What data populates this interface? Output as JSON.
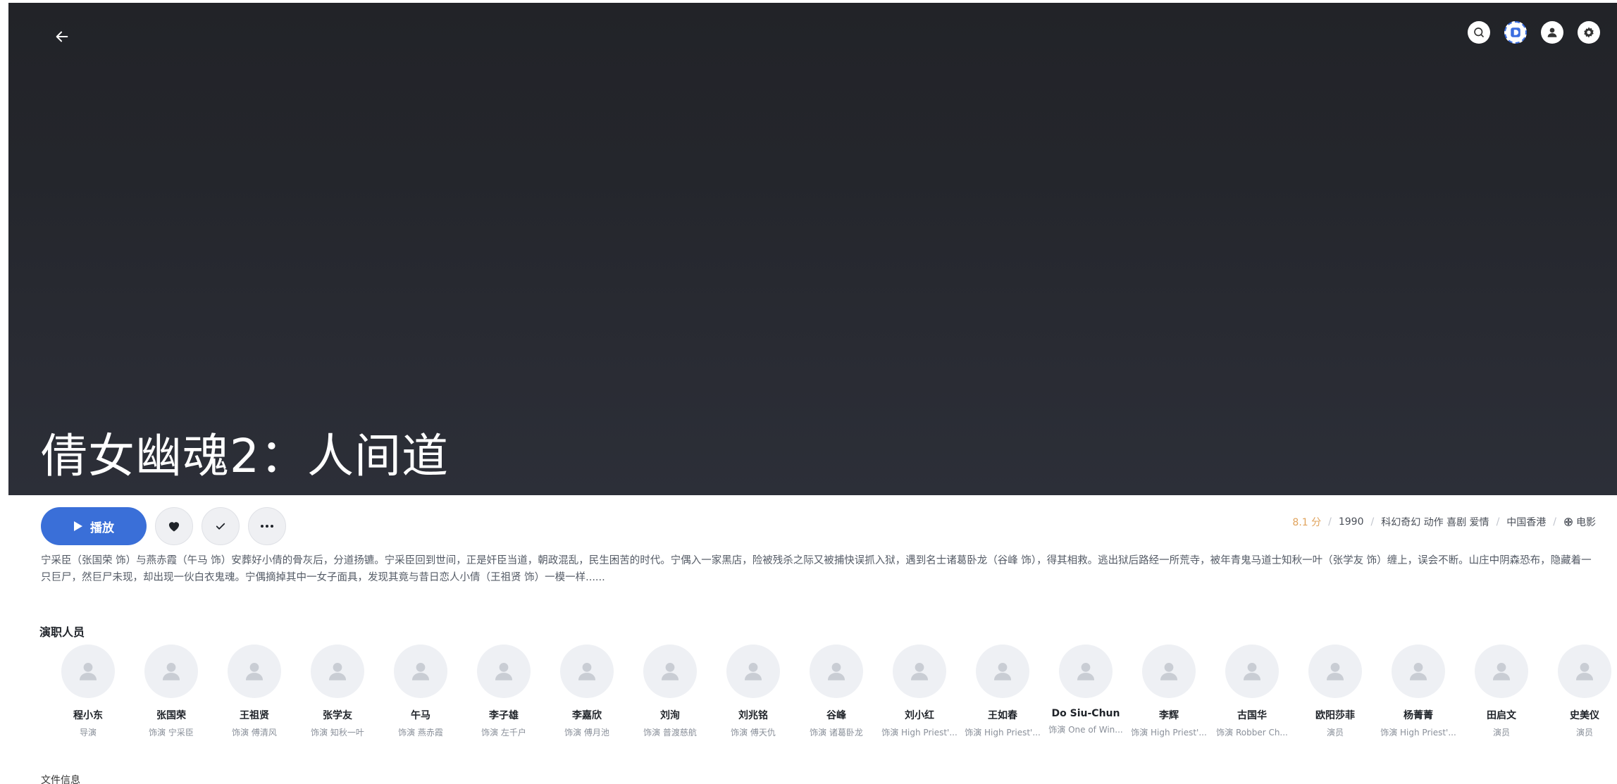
{
  "hero": {
    "title": "倩女幽魂2：人间道"
  },
  "topbar": {
    "back_icon": "arrow-left-icon",
    "actions": [
      "search-icon",
      "brand-d-icon",
      "user-icon",
      "gear-icon"
    ],
    "brand_letter": "D"
  },
  "actions": {
    "play_label": "播放",
    "play_color": "#3a6fd8"
  },
  "meta": {
    "rating": "8.1 分",
    "year": "1990",
    "genres": "科幻奇幻 动作 喜剧 爱情",
    "region": "中国香港",
    "type": "电影",
    "rating_color": "#e0a35c"
  },
  "overview": "宁采臣（张国荣 饰）与燕赤霞（午马 饰）安葬好小倩的骨灰后，分道扬镳。宁采臣回到世间，正是奸臣当道，朝政混乱，民生困苦的时代。宁偶入一家黑店，险被残杀之际又被捕快误抓入狱，遇到名士诸葛卧龙（谷峰 饰），得其相救。逃出狱后路经一所荒寺，被年青鬼马道士知秋一叶（张学友 饰）缠上，误会不断。山庄中阴森恐布，隐藏着一只巨尸，然巨尸未现，却出现一伙白衣鬼魂。宁偶摘掉其中一女子面具，发现其竟与昔日恋人小倩（王祖贤 饰）一模一样......",
  "cast_section": {
    "title": "演职人员",
    "people": [
      {
        "name": "程小东",
        "role": "导演"
      },
      {
        "name": "张国荣",
        "role": "饰演 宁采臣"
      },
      {
        "name": "王祖贤",
        "role": "饰演 傅清风"
      },
      {
        "name": "张学友",
        "role": "饰演 知秋一叶"
      },
      {
        "name": "午马",
        "role": "饰演 燕赤霞"
      },
      {
        "name": "李子雄",
        "role": "饰演 左千户"
      },
      {
        "name": "李嘉欣",
        "role": "饰演 傅月池"
      },
      {
        "name": "刘洵",
        "role": "饰演 普渡慈航"
      },
      {
        "name": "刘兆铭",
        "role": "饰演 傅天仇"
      },
      {
        "name": "谷峰",
        "role": "饰演 诸葛卧龙"
      },
      {
        "name": "刘小红",
        "role": "饰演 High Priest'..."
      },
      {
        "name": "王如春",
        "role": "饰演 High Priest'..."
      },
      {
        "name": "Do Siu-Chun",
        "role": "饰演 One of Win..."
      },
      {
        "name": "李辉",
        "role": "饰演 High Priest'..."
      },
      {
        "name": "古国华",
        "role": "饰演 Robber Ch..."
      },
      {
        "name": "欧阳莎菲",
        "role": "演员"
      },
      {
        "name": "杨菁菁",
        "role": "饰演 High Priest'..."
      },
      {
        "name": "田启文",
        "role": "演员"
      },
      {
        "name": "史美仪",
        "role": "演员"
      }
    ]
  },
  "file_section": {
    "title": "文件信息"
  }
}
